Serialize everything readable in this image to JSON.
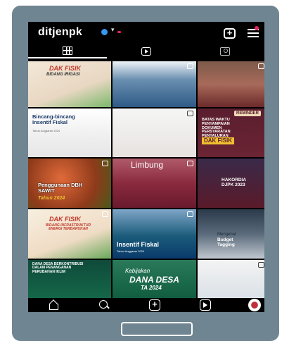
{
  "header": {
    "username": "ditjenpk"
  },
  "tabs": [
    {
      "name": "grid-icon"
    },
    {
      "name": "reels-icon"
    },
    {
      "name": "tagged-icon"
    }
  ],
  "posts": [
    {
      "title": "DAK FISIK",
      "subtitle": "BIDANG IRIGASI"
    },
    {
      "title": "",
      "subtitle": ""
    },
    {
      "title": "",
      "subtitle": ""
    },
    {
      "title": "Bincang-bincang Insentif Fiskal",
      "subtitle": "Tahun Anggaran 2024"
    },
    {
      "title": "",
      "subtitle": ""
    },
    {
      "title": "BATAS WAKTU PENYAMPAIAN DOKUMEN PERSYARATAN PENYALURAN",
      "subtitle": "DAK FISIK",
      "tag": "REMINDER"
    },
    {
      "title": "Penggunaan DBH SAWIT",
      "subtitle": "Tahun 2024"
    },
    {
      "title": "Limbung",
      "subtitle": ""
    },
    {
      "title": "HAKORDIA DJPK 2023",
      "subtitle": ""
    },
    {
      "title": "DAK FISIK",
      "subtitle": "BIDANG INFRASTRUKTUR ENERGI TERBARUKAN"
    },
    {
      "title": "Insentif Fiskal",
      "subtitle": "Tahun Anggaran 2024"
    },
    {
      "title": "Budget Tagging",
      "subtitle": "Mengenal"
    },
    {
      "title": "DANA DESA BERKONTRIBUSI DALAM PENANGANAN PERUBAHAN IKLIM",
      "subtitle": ""
    },
    {
      "title": "DANA DESA",
      "subtitle": "Kebijakan",
      "year": "TA 2024"
    },
    {
      "title": "",
      "subtitle": ""
    }
  ],
  "bottom_nav": [
    {
      "name": "home-icon"
    },
    {
      "name": "search-icon"
    },
    {
      "name": "add-post-icon",
      "glyph": "+"
    },
    {
      "name": "reels-nav-icon"
    },
    {
      "name": "profile-avatar"
    }
  ]
}
